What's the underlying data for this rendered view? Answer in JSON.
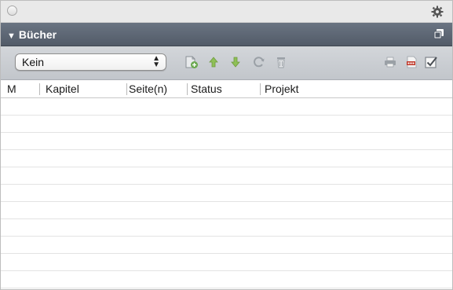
{
  "window": {
    "close_icon": "circle-icon",
    "settings_icon": "gear-icon"
  },
  "panel": {
    "title": "Bücher",
    "collapse_icon": "disclosure-triangle-down-icon",
    "detach_icon": "detach-panel-icon"
  },
  "toolbar": {
    "book_select": {
      "value": "Kein",
      "arrows_icon": "updown-arrows-icon"
    },
    "icons": [
      "add-chapter-icon",
      "move-up-icon",
      "move-down-icon",
      "sync-icon",
      "delete-icon",
      "print-icon",
      "export-pdf-icon",
      "preflight-check-icon"
    ],
    "colors": {
      "add": "#6aa84f",
      "up": "#8fc057",
      "down": "#8fc057",
      "neutral": "#9aa0a6",
      "pdf": "#c0392b"
    }
  },
  "table": {
    "columns": [
      "M",
      "Kapitel",
      "Seite(n)",
      "Status",
      "Projekt"
    ],
    "rows": []
  },
  "colors": {
    "header_bg": "#5d6673",
    "toolbar_bg": "#c8ccd1",
    "row_line": "#e3e3e3"
  }
}
